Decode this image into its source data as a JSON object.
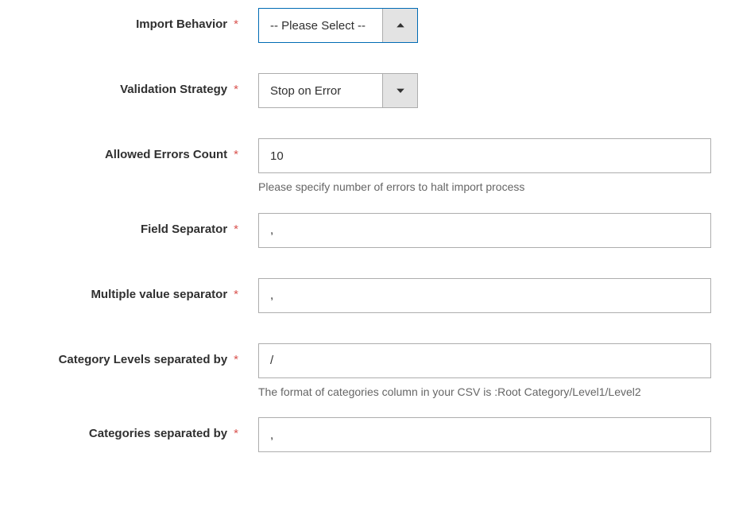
{
  "form": {
    "import_behavior": {
      "label": "Import Behavior",
      "value": "-- Please Select --"
    },
    "validation_strategy": {
      "label": "Validation Strategy",
      "value": "Stop on Error"
    },
    "allowed_errors": {
      "label": "Allowed Errors Count",
      "value": "10",
      "help": "Please specify number of errors to halt import process"
    },
    "field_separator": {
      "label": "Field Separator",
      "value": ","
    },
    "multiple_separator": {
      "label": "Multiple value separator",
      "value": ","
    },
    "category_levels_sep": {
      "label": "Category Levels separated by",
      "value": "/",
      "help": "The format of categories column in your CSV is :Root Category/Level1/Level2"
    },
    "categories_sep": {
      "label": "Categories separated by",
      "value": ","
    },
    "required_mark": "*"
  }
}
